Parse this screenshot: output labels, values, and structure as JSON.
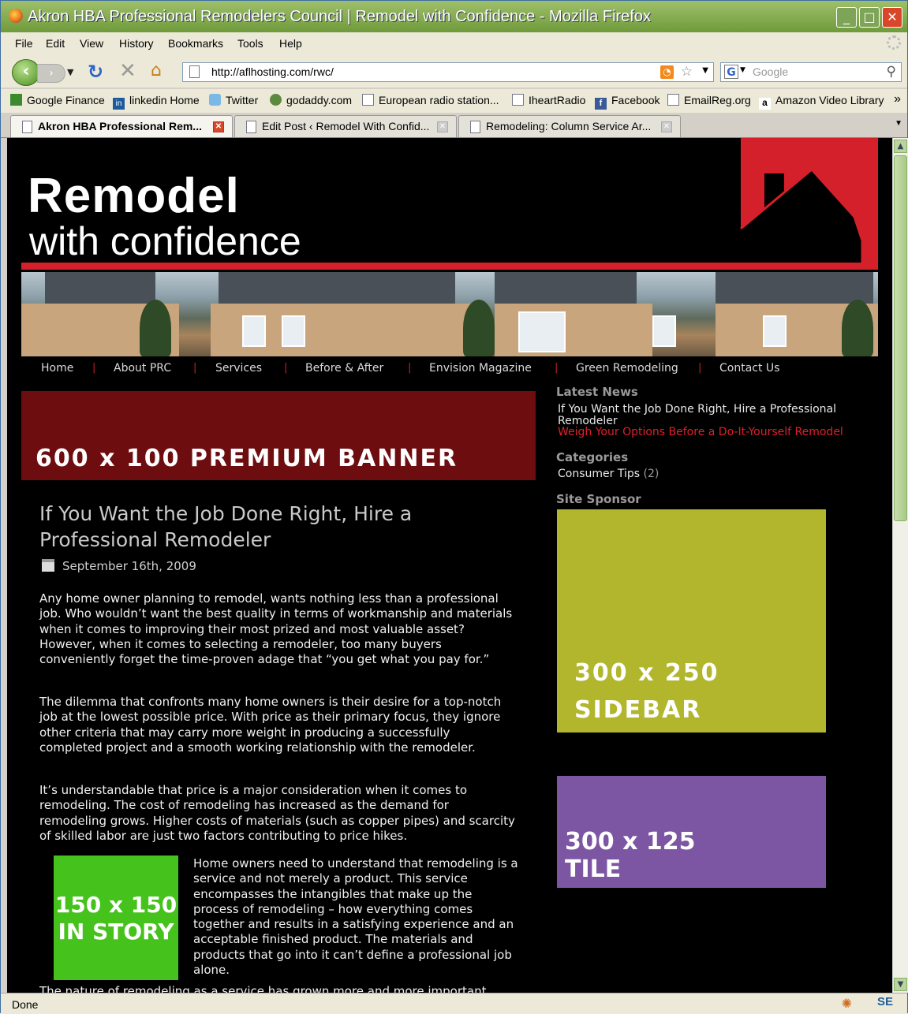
{
  "window": {
    "title": "Akron HBA Professional Remodelers Council | Remodel with Confidence - Mozilla Firefox"
  },
  "menu": [
    "File",
    "Edit",
    "View",
    "History",
    "Bookmarks",
    "Tools",
    "Help"
  ],
  "address": {
    "url": "http://aflhosting.com/rwc/",
    "search_placeholder": "Google"
  },
  "bookmarks": [
    "Google Finance",
    "linkedin Home",
    "Twitter",
    "godaddy.com",
    "European radio station...",
    "IheartRadio",
    "Facebook",
    "EmailReg.org",
    "Amazon Video Library"
  ],
  "tabs": [
    {
      "label": "Akron HBA Professional Rem..."
    },
    {
      "label": "Edit Post ‹ Remodel With Confid..."
    },
    {
      "label": "Remodeling: Column Service Ar..."
    }
  ],
  "status": {
    "text": "Done"
  },
  "site": {
    "logo_top": "Remodel",
    "logo_bottom": "with confidence",
    "nav": [
      "Home",
      "About PRC",
      "Services",
      "Before & After",
      "Envision Magazine",
      "Green Remodeling",
      "Contact Us"
    ],
    "premium_banner": "600 x 100 PREMIUM BANNER",
    "post": {
      "title": "If You Want the Job Done Right, Hire a Professional Remodeler",
      "date": "September 16th, 2009",
      "p1": "Any home owner planning to remodel, wants nothing less than a professional job.  Who wouldn’t want the best quality in terms of workmanship and materials when it comes to improving their most prized and most valuable asset?  However, when it comes to selecting a remodeler, too many buyers conveniently forget the time-proven adage that “you get what you pay for.”",
      "p2": "The dilemma that confronts many home owners is their desire for a top-notch job at the lowest possible price.  With price as their primary focus, they ignore other criteria that may carry more weight in producing a successfully completed project and a smooth working relationship with the remodeler.",
      "p3": "It’s understandable that price is a major consideration when it comes to remodeling.  The cost of remodeling has increased as the demand for remodeling grows.  Higher costs of materials (such as copper pipes) and scarcity of skilled labor are just two factors contributing to price hikes.",
      "p4": "Home owners need to understand that remodeling is a service and not merely a product.  This service encompasses the intangibles that make up the process of remodeling – how everything comes together and results in a satisfying experience and an acceptable finished product.  The materials and products that go into it can’t define a professional job alone.",
      "in_story_line1": "150 x 150",
      "in_story_line2": "IN STORY",
      "cut_text": "The nature of remodeling as a service has grown more and more important"
    },
    "sidebar": {
      "latest_news_heading": "Latest News",
      "news_items": [
        "If You Want the Job Done Right, Hire a Professional Remodeler",
        "Weigh Your Options Before a Do-It-Yourself Remodel"
      ],
      "categories_heading": "Categories",
      "category": "Consumer Tips",
      "category_count": "(2)",
      "sponsor_heading": "Site Sponsor",
      "sidebar_ad_line1": "300 x 250",
      "sidebar_ad_line2": "SIDEBAR",
      "tile_line1": "300 x 125",
      "tile_line2": "TILE"
    }
  },
  "colors": {
    "nav_separator": "#c7202b",
    "accent_red": "#d4202b",
    "news_link_active": "#e0202b",
    "sidebar_ad": "#b1b62d",
    "tile_ad": "#7c56a2",
    "in_story_ad": "#46c21c",
    "banner": "#6d0d0f"
  }
}
